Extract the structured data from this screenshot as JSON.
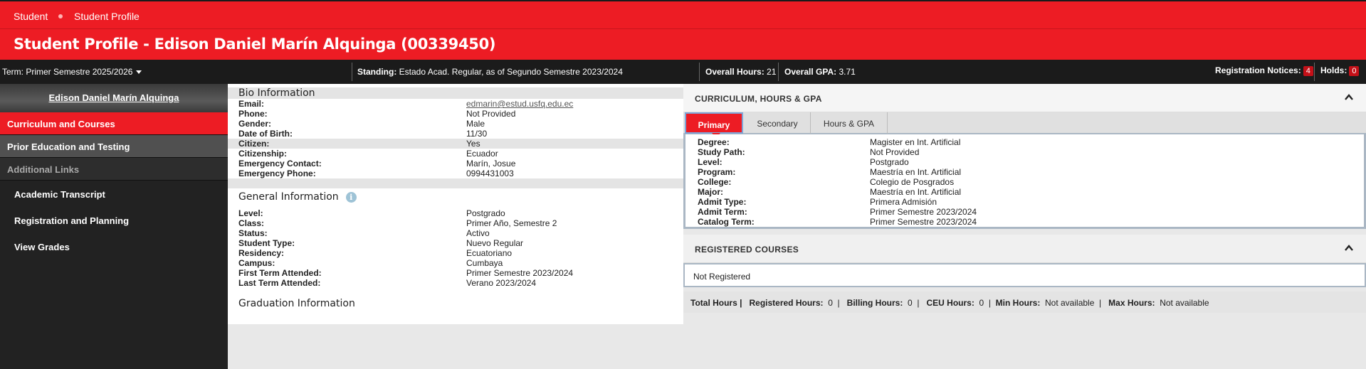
{
  "breadcrumb": [
    "Student",
    "Student Profile"
  ],
  "page_title": "Student Profile - Edison Daniel Marín Alquinga (00339450)",
  "info_bar": {
    "term_label": "Term:",
    "term_value": "Primer Semestre 2025/2026",
    "standing_label": "Standing:",
    "standing_value": "Estado Acad. Regular, as of Segundo Semestre 2023/2024",
    "hours_label": "Overall Hours:",
    "hours_value": "21",
    "gpa_label": "Overall GPA:",
    "gpa_value": "3.71",
    "notices_label": "Registration Notices:",
    "notices_count": "4",
    "holds_label": "Holds:",
    "holds_count": "0"
  },
  "sidebar": {
    "user_name": "Edison Daniel Marín Alquinga",
    "items": [
      "Curriculum and Courses",
      "Prior Education and Testing"
    ],
    "additional_links_label": "Additional Links",
    "links": [
      "Academic Transcript",
      "Registration and Planning",
      "View Grades"
    ]
  },
  "bio": {
    "title": "Bio Information",
    "rows": [
      {
        "label": "Email:",
        "value": "edmarin@estud.usfq.edu.ec"
      },
      {
        "label": "Phone:",
        "value": "Not Provided"
      },
      {
        "label": "Gender:",
        "value": "Male"
      },
      {
        "label": "Date of Birth:",
        "value": "11/30"
      },
      {
        "label": "Citizen:",
        "value": "Yes"
      },
      {
        "label": "Citizenship:",
        "value": "Ecuador"
      },
      {
        "label": "Emergency Contact:",
        "value": "Marín, Josue"
      },
      {
        "label": "Emergency Phone:",
        "value": "0994431003"
      }
    ]
  },
  "general": {
    "title": "General Information",
    "rows": [
      {
        "label": "Level:",
        "value": "Postgrado"
      },
      {
        "label": "Class:",
        "value": "Primer Año, Semestre 2"
      },
      {
        "label": "Status:",
        "value": "Activo"
      },
      {
        "label": "Student Type:",
        "value": "Nuevo Regular"
      },
      {
        "label": "Residency:",
        "value": "Ecuatoriano"
      },
      {
        "label": "Campus:",
        "value": "Cumbaya"
      },
      {
        "label": "First Term Attended:",
        "value": "Primer Semestre 2023/2024"
      },
      {
        "label": "Last Term Attended:",
        "value": "Verano 2023/2024"
      }
    ]
  },
  "graduation": {
    "title": "Graduation Information"
  },
  "curriculum": {
    "title": "CURRICULUM, HOURS & GPA",
    "tabs": [
      "Primary",
      "Secondary",
      "Hours & GPA"
    ],
    "rows": [
      {
        "label": "Degree:",
        "value": "Magister en Int. Artificial"
      },
      {
        "label": "Study Path:",
        "value": "Not Provided"
      },
      {
        "label": "Level:",
        "value": "Postgrado"
      },
      {
        "label": "Program:",
        "value": "Maestría en Int. Artificial"
      },
      {
        "label": "College:",
        "value": "Colegio de Posgrados"
      },
      {
        "label": "Major:",
        "value": "Maestría en Int. Artificial"
      },
      {
        "label": "Admit Type:",
        "value": "Primera Admisión"
      },
      {
        "label": "Admit Term:",
        "value": "Primer Semestre 2023/2024"
      },
      {
        "label": "Catalog Term:",
        "value": "Primer Semestre 2023/2024"
      }
    ]
  },
  "registered": {
    "title": "REGISTERED COURSES",
    "status": "Not Registered",
    "totals_label": "Total Hours |",
    "registered_label": "Registered Hours:",
    "registered_value": "0",
    "billing_label": "Billing Hours:",
    "billing_value": "0",
    "ceu_label": "CEU Hours:",
    "ceu_value": "0",
    "min_label": "Min Hours:",
    "min_value": "Not available",
    "max_label": "Max Hours:",
    "max_value": "Not available"
  },
  "colors": {
    "brand_red": "#ed1c24",
    "dark": "#1b1b1b"
  }
}
